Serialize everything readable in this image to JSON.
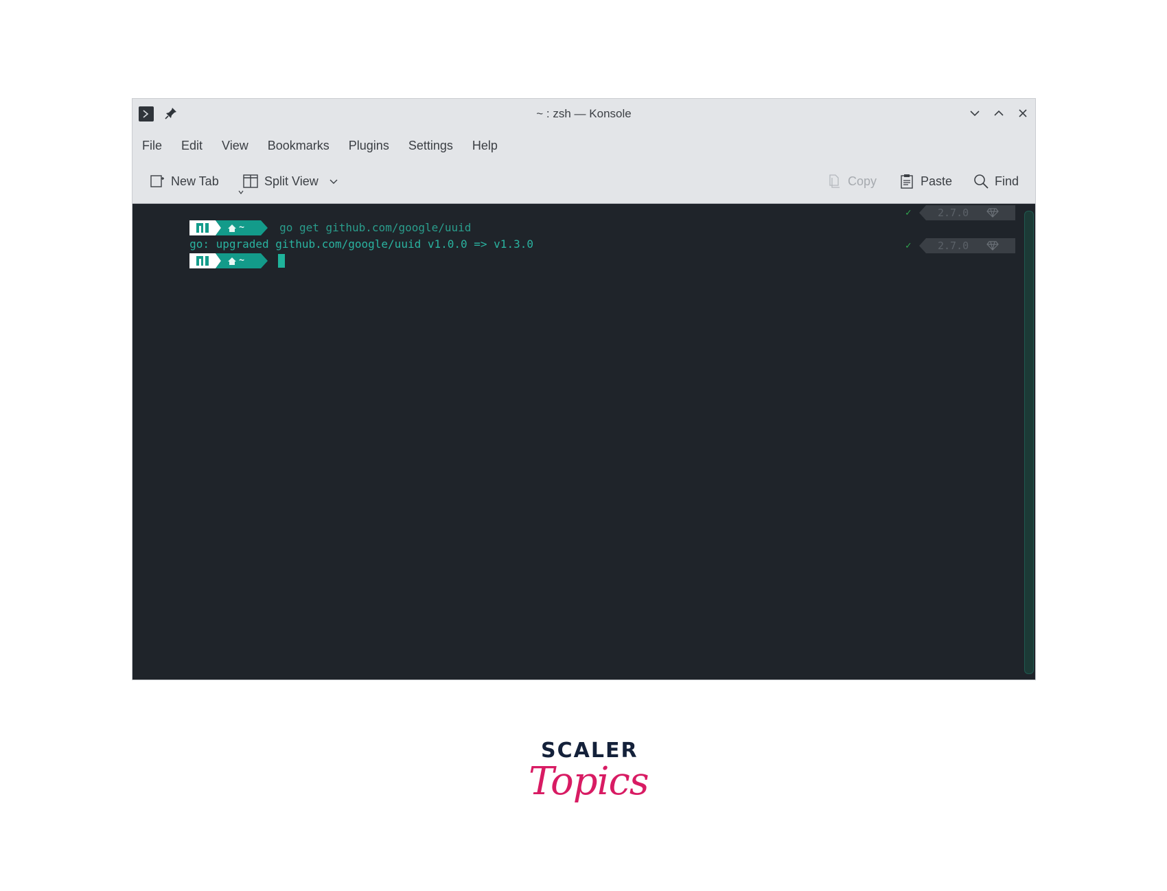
{
  "window": {
    "title": "~ : zsh — Konsole"
  },
  "menubar": {
    "items": [
      "File",
      "Edit",
      "View",
      "Bookmarks",
      "Plugins",
      "Settings",
      "Help"
    ]
  },
  "toolbar": {
    "new_tab": "New Tab",
    "split_view": "Split View",
    "copy": "Copy",
    "paste": "Paste",
    "find": "Find"
  },
  "icons": {
    "app": "terminal-icon",
    "pin": "pin-icon",
    "minimize": "chevron-down-icon",
    "maximize": "chevron-up-icon",
    "close": "close-icon",
    "new_tab": "new-tab-icon",
    "split_view": "split-view-icon",
    "copy": "copy-icon",
    "paste": "paste-icon",
    "find": "search-icon",
    "prompt_os": "manjaro-icon",
    "prompt_home": "home-icon",
    "ruby_version": "gem-icon"
  },
  "terminal": {
    "prompt_dir": "~",
    "command": "go get github.com/google/uuid",
    "output": "go: upgraded github.com/google/uuid v1.0.0 => v1.3.0",
    "status_check": "✓",
    "ruby_version": "2.7.0"
  },
  "colors": {
    "terminal_bg": "#1f242a",
    "prompt_teal": "#139b8a",
    "command_text": "#2a9d8c",
    "output_text": "#2ab3a0",
    "check_green": "#2fa94f",
    "logo_navy": "#14213a",
    "logo_pink": "#d81b63"
  },
  "logo": {
    "word": "SCALER",
    "script": "Topics"
  }
}
